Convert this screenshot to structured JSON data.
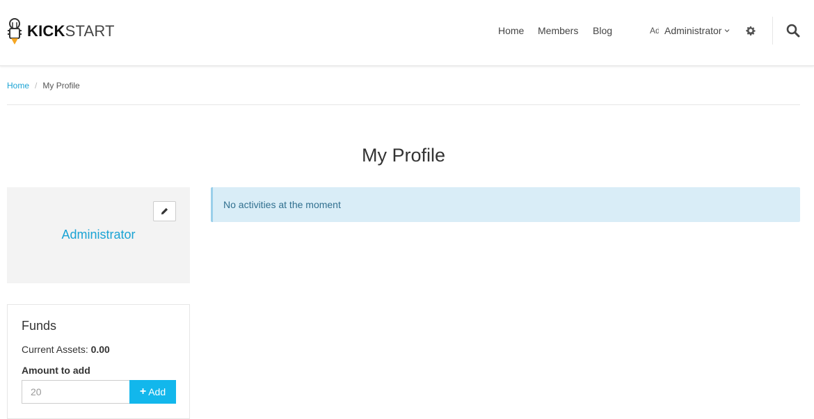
{
  "header": {
    "logo": {
      "bold": "KICK",
      "light": "START"
    },
    "nav": [
      {
        "label": "Home"
      },
      {
        "label": "Members"
      },
      {
        "label": "Blog"
      }
    ],
    "user_menu": {
      "initials": "Ad",
      "label": "Administrator"
    },
    "icons": {
      "settings": "gear-icon",
      "search": "search-icon",
      "dropdown": "chevron-down-icon"
    }
  },
  "breadcrumb": {
    "home": "Home",
    "separator": "/",
    "current": "My Profile"
  },
  "page": {
    "title": "My Profile"
  },
  "profile": {
    "name": "Administrator",
    "edit_icon": "pencil-icon"
  },
  "activity": {
    "message": "No activities at the moment"
  },
  "funds": {
    "title": "Funds",
    "current_assets_label": "Current Assets:",
    "current_assets_value": "0.00",
    "amount_label": "Amount to add",
    "amount_placeholder": "20",
    "add_icon": "+",
    "add_label": "Add"
  },
  "colors": {
    "link": "#1aa3d4",
    "button": "#12b7ec",
    "alert_bg": "#d9edf7",
    "alert_text": "#31708f",
    "card_bg": "#f3f3f3"
  }
}
